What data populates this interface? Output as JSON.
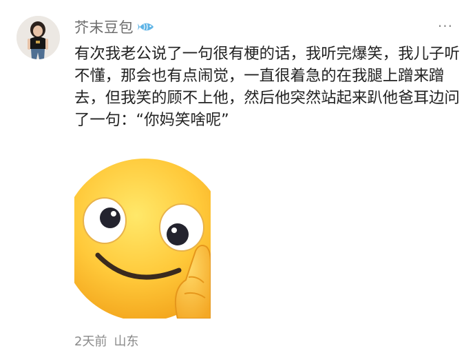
{
  "post": {
    "username": "芥末豆包",
    "badge_icon": "fish-badge-icon",
    "more_icon": "more-dots-icon",
    "more_label": "···",
    "text": "有次我老公说了一句很有梗的话，我听完爆笑，我儿子听不懂，那会也有点闹觉，一直很着急的在我腿上蹭来蹭去，但我笑的顾不上他，然后他突然站起来趴他爸耳边问了一句：“你妈笑啥呢”",
    "sticker_icon": "smile-peek-emoji-icon",
    "time": "2天前",
    "location": "山东"
  },
  "colors": {
    "username": "#6d6d6d",
    "text": "#222222",
    "meta": "#8a8a8a",
    "badge": "#5fb4e6"
  }
}
